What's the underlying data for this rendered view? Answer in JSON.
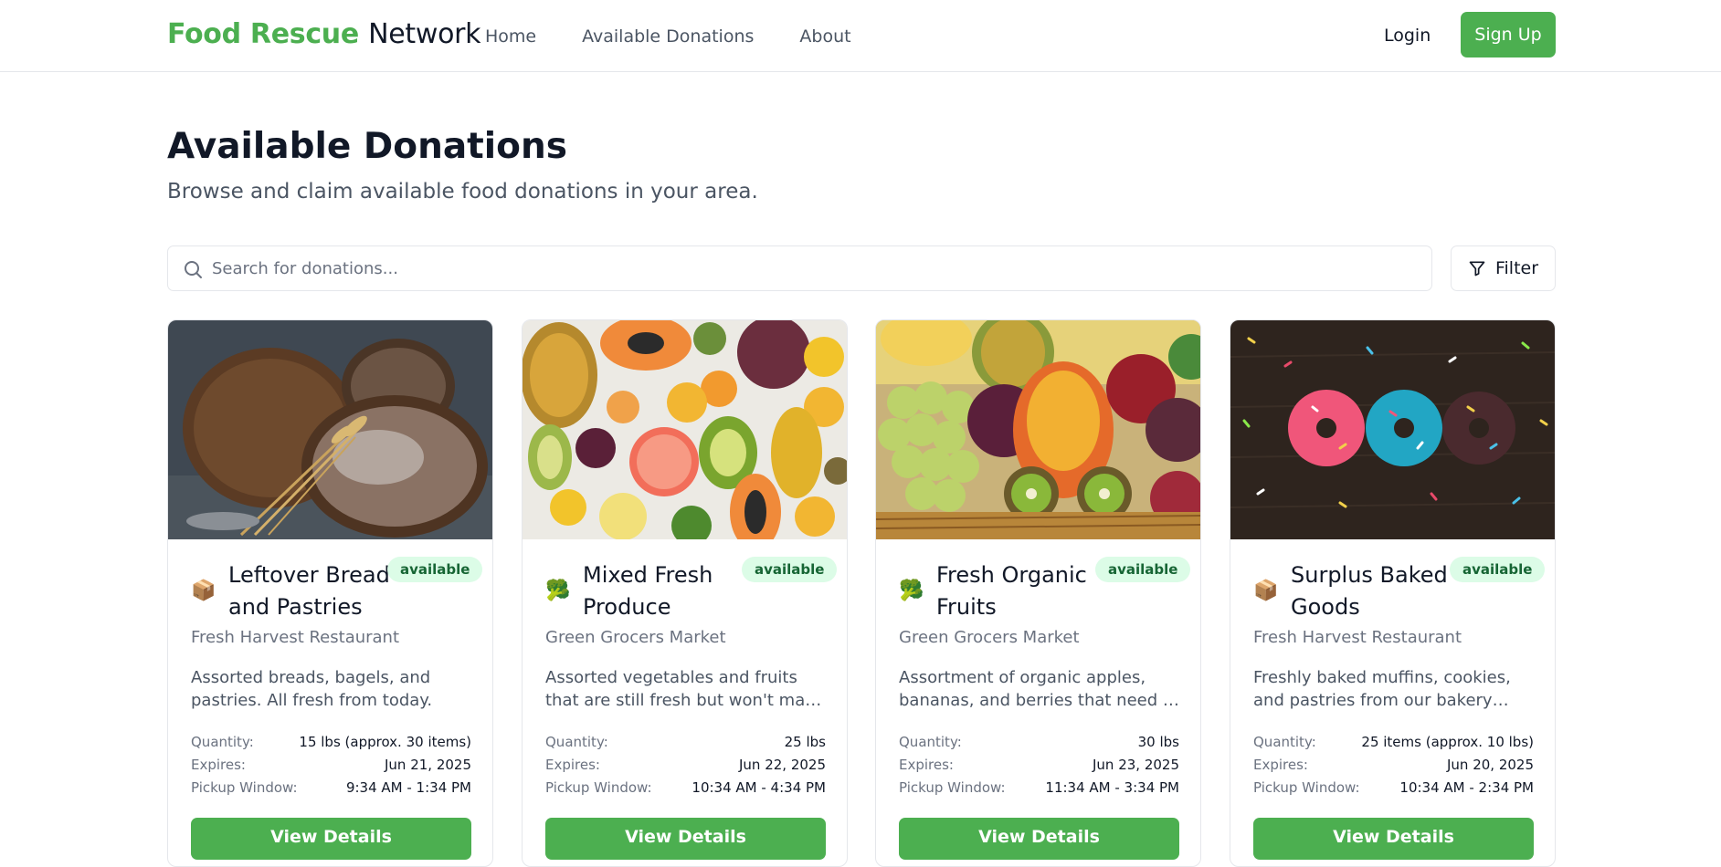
{
  "header": {
    "brand_part1": "Food Rescue",
    "brand_part2": "Network",
    "nav": [
      "Home",
      "Available Donations",
      "About"
    ],
    "login_label": "Login",
    "signup_label": "Sign Up"
  },
  "page": {
    "title": "Available Donations",
    "subtitle": "Browse and claim available food donations in your area."
  },
  "search": {
    "placeholder": "Search for donations...",
    "filter_label": "Filter"
  },
  "labels": {
    "quantity": "Quantity:",
    "expires": "Expires:",
    "pickup": "Pickup Window:",
    "view_details": "View Details"
  },
  "colors": {
    "brand_green": "#4caf50",
    "badge_bg": "#dcfce7",
    "badge_text": "#166534"
  },
  "cards": [
    {
      "title": "Leftover Bread and Pastries",
      "type_icon": "package-icon",
      "status": "available",
      "org": "Fresh Harvest Restaurant",
      "description": "Assorted breads, bagels, and pastries. All fresh from today.",
      "quantity": "15 lbs (approx. 30 items)",
      "expires": "Jun 21, 2025",
      "pickup": "9:34 AM - 1:34 PM",
      "image": "bread-loaves-image"
    },
    {
      "title": "Mixed Fresh Produce",
      "type_icon": "broccoli-icon",
      "status": "available",
      "org": "Green Grocers Market",
      "description": "Assorted vegetables and fruits that are still fresh but won't make it to...",
      "quantity": "25 lbs",
      "expires": "Jun 22, 2025",
      "pickup": "10:34 AM - 4:34 PM",
      "image": "mixed-fruits-image"
    },
    {
      "title": "Fresh Organic Fruits",
      "type_icon": "broccoli-icon",
      "status": "available",
      "org": "Green Grocers Market",
      "description": "Assortment of organic apples, bananas, and berries that need to b...",
      "quantity": "30 lbs",
      "expires": "Jun 23, 2025",
      "pickup": "11:34 AM - 3:34 PM",
      "image": "fruit-basket-image"
    },
    {
      "title": "Surplus Baked Goods",
      "type_icon": "package-icon",
      "status": "available",
      "org": "Fresh Harvest Restaurant",
      "description": "Freshly baked muffins, cookies, and pastries from our bakery section. St...",
      "quantity": "25 items (approx. 10 lbs)",
      "expires": "Jun 20, 2025",
      "pickup": "10:34 AM - 2:34 PM",
      "image": "donuts-image"
    }
  ]
}
